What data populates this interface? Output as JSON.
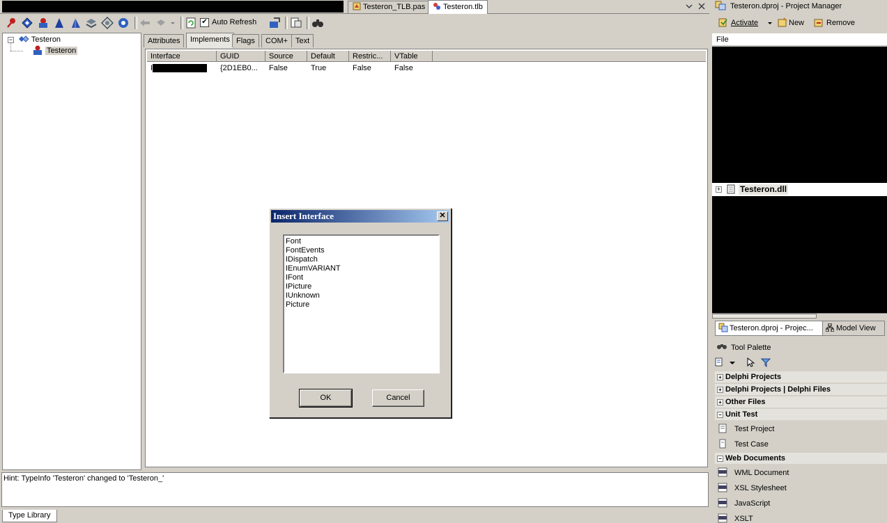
{
  "editor_tabs": [
    {
      "label": "Testeron_TLB.pas",
      "icon": "pas-file-icon"
    },
    {
      "label": "Testeron.tlb",
      "icon": "type-library-icon",
      "active": true
    }
  ],
  "toolbar": {
    "auto_refresh_label": "Auto Refresh",
    "auto_refresh_checked": true
  },
  "tree": {
    "root": "Testeron",
    "child": "Testeron"
  },
  "page_tabs": [
    "Attributes",
    "Implements",
    "Flags",
    "COM+",
    "Text"
  ],
  "active_page_tab": "Implements",
  "grid": {
    "columns": [
      "Interface",
      "GUID",
      "Source",
      "Default",
      "Restric...",
      "VTable"
    ],
    "rows": [
      {
        "interface": "I",
        "guid": "{2D1EB0...",
        "source": "False",
        "default": "True",
        "restricted": "False",
        "vtable": "False"
      }
    ]
  },
  "dialog": {
    "title": "Insert Interface",
    "items": [
      "Font",
      "FontEvents",
      "IDispatch",
      "IEnumVARIANT",
      "IFont",
      "IPicture",
      "IUnknown",
      "Picture"
    ],
    "ok_label": "OK",
    "cancel_label": "Cancel"
  },
  "messages": {
    "hint": "Hint: TypeInfo 'Testeron' changed to 'Testeron_'",
    "tab_label": "Type Library"
  },
  "project_manager": {
    "title": "Testeron.dproj - Project Manager",
    "activate_label": "Activate",
    "new_label": "New",
    "remove_label": "Remove",
    "column_header": "File",
    "project_node": "Testeron.dll",
    "bottom_tabs": [
      "Testeron.dproj - Projec...",
      "Model View"
    ]
  },
  "tool_palette": {
    "title": "Tool Palette",
    "categories": [
      {
        "label": "Delphi Projects",
        "expanded": false
      },
      {
        "label": "Delphi Projects | Delphi Files",
        "expanded": false
      },
      {
        "label": "Other Files",
        "expanded": false
      },
      {
        "label": "Unit Test",
        "expanded": true,
        "items": [
          "Test Project",
          "Test Case"
        ]
      },
      {
        "label": "Web Documents",
        "expanded": true,
        "items": [
          "WML Document",
          "XSL Stylesheet",
          "JavaScript",
          "XSLT"
        ]
      }
    ]
  }
}
